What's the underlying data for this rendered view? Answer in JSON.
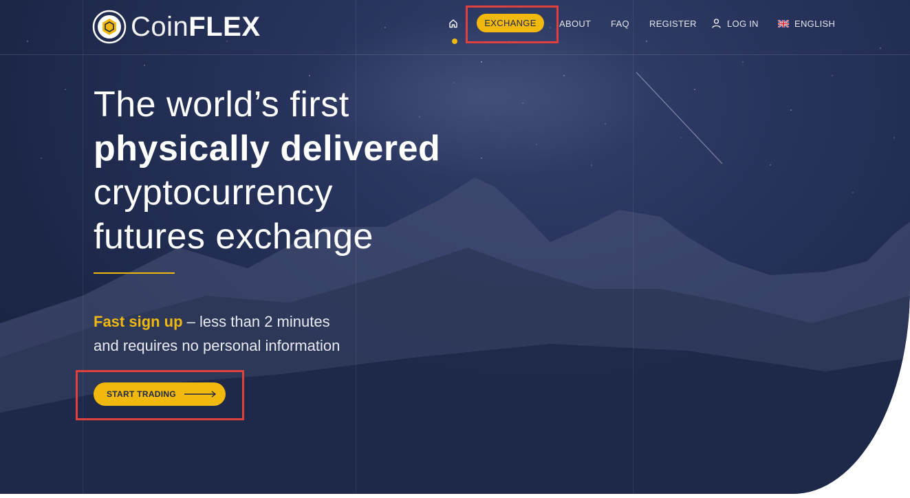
{
  "brand": {
    "name_light": "Coin",
    "name_bold": "FLEX"
  },
  "nav": {
    "home_icon": "home-icon",
    "exchange": "EXCHANGE",
    "about": "ABOUT",
    "faq": "FAQ",
    "register": "REGISTER",
    "login": "LOG IN",
    "language": "ENGLISH",
    "language_icon": "uk-flag-icon"
  },
  "hero": {
    "headline_line1": "The world’s first",
    "headline_line2": "physically delivered",
    "headline_line3": "cryptocurrency",
    "headline_line4": "futures exchange",
    "sub_accent": "Fast sign up",
    "sub_rest": " – less than 2 minutes",
    "sub_line2": "and requires no personal information",
    "cta_label": "START TRADING",
    "cta_icon": "arrow-right-icon"
  },
  "colors": {
    "accent": "#f1b90e",
    "background": "#1c2748",
    "highlight_box": "#e2403d"
  }
}
